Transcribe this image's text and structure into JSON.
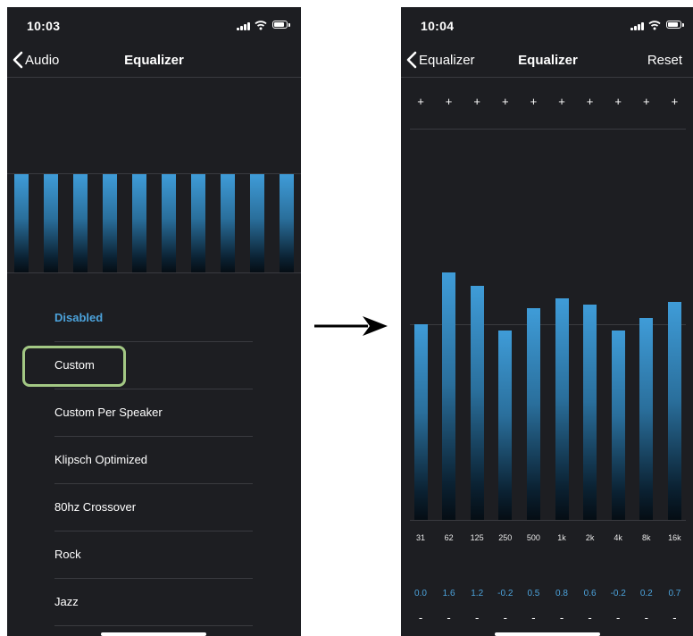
{
  "left_screen": {
    "status": {
      "time": "10:03"
    },
    "nav": {
      "back_label": "Audio",
      "title": "Equalizer"
    },
    "preview_bar_count": 10,
    "presets": [
      {
        "label": "Disabled",
        "selected": true
      },
      {
        "label": "Custom",
        "selected": false
      },
      {
        "label": "Custom Per Speaker",
        "selected": false
      },
      {
        "label": "Klipsch Optimized",
        "selected": false
      },
      {
        "label": "80hz Crossover",
        "selected": false
      },
      {
        "label": "Rock",
        "selected": false
      },
      {
        "label": "Jazz",
        "selected": false
      }
    ]
  },
  "right_screen": {
    "status": {
      "time": "10:04"
    },
    "nav": {
      "back_label": "Equalizer",
      "title": "Equalizer",
      "reset_label": "Reset"
    },
    "plus_symbol": "+",
    "minus_symbol": "-",
    "bands": [
      {
        "freq": "31",
        "gain": "0.0",
        "value": 0.0
      },
      {
        "freq": "62",
        "gain": "1.6",
        "value": 1.6
      },
      {
        "freq": "125",
        "gain": "1.2",
        "value": 1.2
      },
      {
        "freq": "250",
        "gain": "-0.2",
        "value": -0.2
      },
      {
        "freq": "500",
        "gain": "0.5",
        "value": 0.5
      },
      {
        "freq": "1k",
        "gain": "0.8",
        "value": 0.8
      },
      {
        "freq": "2k",
        "gain": "0.6",
        "value": 0.6
      },
      {
        "freq": "4k",
        "gain": "-0.2",
        "value": -0.2
      },
      {
        "freq": "8k",
        "gain": "0.2",
        "value": 0.2
      },
      {
        "freq": "16k",
        "gain": "0.7",
        "value": 0.7
      }
    ]
  },
  "colors": {
    "screen_bg": "#1d1e22",
    "accent": "#4ca3dc",
    "bar_top": "#3f9cd8",
    "highlight": "#a3c884"
  }
}
